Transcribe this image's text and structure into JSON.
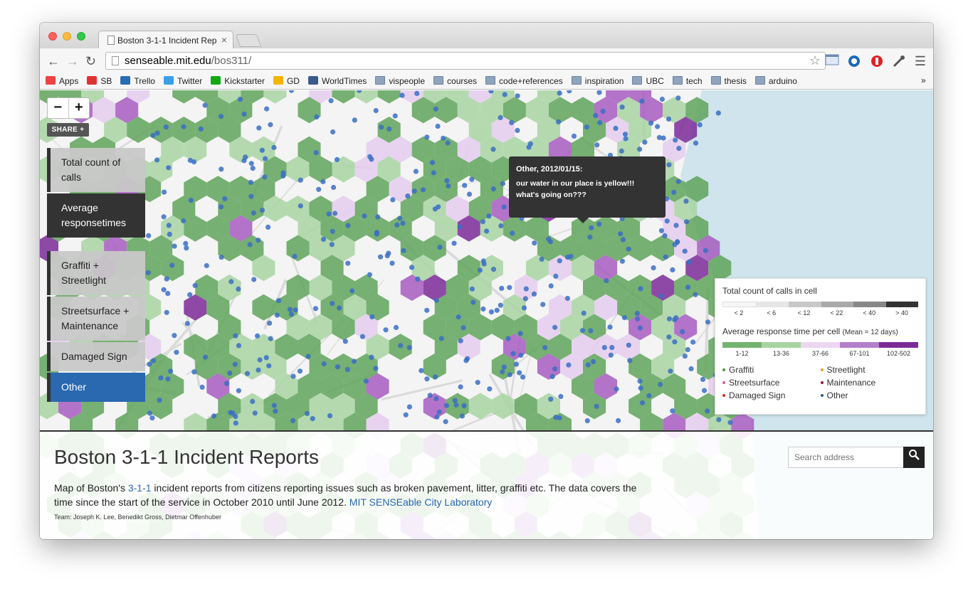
{
  "browser": {
    "tab_title": "Boston 3-1-1 Incident Rep",
    "tab_close": "×",
    "url_host": "senseable.mit.edu",
    "url_path": "/bos311/",
    "back_glyph": "←",
    "forward_glyph": "→",
    "reload_glyph": "↻",
    "star_glyph": "☆",
    "menu_glyph": "☰",
    "bookmarks": [
      {
        "label": "Apps",
        "icon": "apps-grid-icon"
      },
      {
        "label": "SB",
        "icon": "sb-icon"
      },
      {
        "label": "Trello",
        "icon": "trello-icon"
      },
      {
        "label": "Twitter",
        "icon": "twitter-icon"
      },
      {
        "label": "Kickstarter",
        "icon": "kickstarter-icon"
      },
      {
        "label": "GD",
        "icon": "google-drive-icon"
      },
      {
        "label": "WorldTimes",
        "icon": "worldtimes-icon"
      },
      {
        "label": "vispeople",
        "icon": "folder-icon"
      },
      {
        "label": "courses",
        "icon": "folder-icon"
      },
      {
        "label": "code+references",
        "icon": "folder-icon"
      },
      {
        "label": "inspiration",
        "icon": "folder-icon"
      },
      {
        "label": "UBC",
        "icon": "folder-icon"
      },
      {
        "label": "tech",
        "icon": "folder-icon"
      },
      {
        "label": "thesis",
        "icon": "folder-icon"
      },
      {
        "label": "arduino",
        "icon": "folder-icon"
      }
    ],
    "bookmarks_more": "»"
  },
  "map": {
    "zoom_out": "−",
    "zoom_in": "+",
    "share": "SHARE +",
    "menu": [
      {
        "label": "Total count of calls",
        "state": "inactive"
      },
      {
        "label": "Average responsetimes",
        "state": "selected-dark"
      },
      {
        "label": "Graffiti + Streetlight",
        "state": "inactive"
      },
      {
        "label": "Streetsurface + Maintenance",
        "state": "inactive"
      },
      {
        "label": "Damaged Sign",
        "state": "inactive"
      },
      {
        "label": "Other",
        "state": "active"
      }
    ],
    "tooltip": {
      "title": "Other, 2012/01/15:",
      "text": "our water in our place is yellow!!! what's going on???"
    },
    "colors": {
      "hex_green": "#5fa35a",
      "hex_light_green": "#a8d4a2",
      "hex_light_purple": "#e4cdef",
      "hex_purple": "#a65cbf",
      "hex_dark_purple": "#7b2a98",
      "dot_blue": "#3a6fc4",
      "water": "#cfe4ec"
    }
  },
  "legend": {
    "count_title": "Total count of calls in cell",
    "count_labels": [
      "< 2",
      "< 6",
      "< 12",
      "< 22",
      "< 40",
      "> 40"
    ],
    "count_colors": [
      "#f7f7f7",
      "#e6e6e6",
      "#c8c8c8",
      "#a9a9a9",
      "#888888",
      "#333333"
    ],
    "resp_title": "Average response time per cell",
    "resp_mean": "(Mean = 12 days)",
    "resp_labels": [
      "1-12",
      "13-36",
      "37-66",
      "67-101",
      "102-502"
    ],
    "resp_colors": [
      "#74b36f",
      "#a8d4a2",
      "#ecd6f1",
      "#b47fc9",
      "#7b2a98"
    ],
    "categories": [
      {
        "label": "Graffiti",
        "color": "#4a9a3a"
      },
      {
        "label": "Streetlight",
        "color": "#e7a21a"
      },
      {
        "label": "Streetsurface",
        "color": "#e0559a"
      },
      {
        "label": "Maintenance",
        "color": "#9b1a4a"
      },
      {
        "label": "Damaged Sign",
        "color": "#e0301e"
      },
      {
        "label": "Other",
        "color": "#2a5a8a"
      }
    ]
  },
  "panel": {
    "title": "Boston 3-1-1 Incident Reports",
    "search_placeholder": "Search address",
    "desc_before": "Map of Boston's ",
    "desc_link1": "3-1-1",
    "desc_middle": " incident reports from citizens reporting issues such as broken pavement, litter, graffiti etc. The data covers the time since the start of the service in October 2010 until June 2012. ",
    "desc_link2": "MIT SENSEable City Laboratory",
    "team": "Team: Joseph K. Lee, Benedikt Gross, Dietmar Offenhuber"
  }
}
